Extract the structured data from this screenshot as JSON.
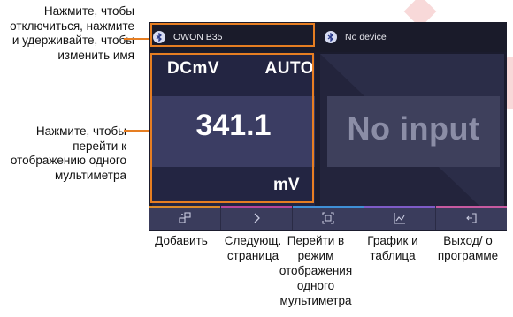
{
  "callouts": {
    "title_hint": "Нажмите, чтобы отключиться, нажмите и удерживайте, чтобы изменить имя",
    "meter_hint": "Нажмите, чтобы перейти к отображению одного мультиметра"
  },
  "devices": [
    {
      "name": "OWON B35",
      "icon": "bluetooth-icon"
    },
    {
      "name": "No device",
      "icon": "bluetooth-icon"
    }
  ],
  "meter_left": {
    "mode": "DCmV",
    "range": "AUTO",
    "reading": "341.1",
    "unit": "mV"
  },
  "meter_right": {
    "status": "No input"
  },
  "toolbar": {
    "buttons": [
      {
        "icon": "add-device-icon",
        "accent": "#d98a2b",
        "caption": "Добавить"
      },
      {
        "icon": "chevron-right-icon",
        "accent": "#b8459a",
        "caption": "Следующ. страница"
      },
      {
        "icon": "single-meter-icon",
        "accent": "#3f8fd6",
        "caption": "Перейти в режим отображения одного мультиметра"
      },
      {
        "icon": "chart-icon",
        "accent": "#7e5bc7",
        "caption": "График и таблица"
      },
      {
        "icon": "exit-icon",
        "accent": "#c65aa0",
        "caption": "Выход/ о программе"
      }
    ]
  },
  "colors": {
    "highlight": "#e67e22",
    "screen_bg": "#1b1c2e"
  }
}
